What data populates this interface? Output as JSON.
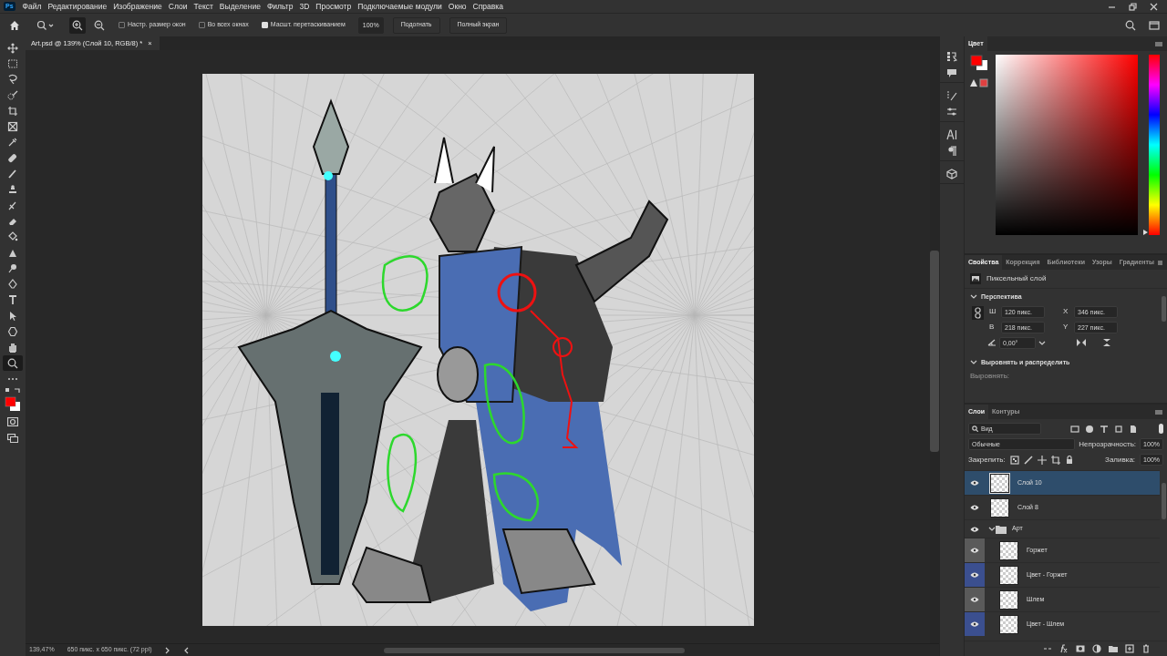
{
  "app_logo": "Ps",
  "menu": [
    "Файл",
    "Редактирование",
    "Изображение",
    "Слои",
    "Текст",
    "Выделение",
    "Фильтр",
    "3D",
    "Просмотр",
    "Подключаемые модули",
    "Окно",
    "Справка"
  ],
  "options_bar": {
    "zoom_in_selected": true,
    "checkboxes": [
      {
        "label": "Настр. размер окон",
        "checked": false
      },
      {
        "label": "Во всех окнах",
        "checked": false
      },
      {
        "label": "Масшт. перетаскиванием",
        "checked": true
      }
    ],
    "zoom_value": "100%",
    "buttons": [
      "Подогнать",
      "Полный экран"
    ]
  },
  "tools": [
    {
      "selected": false
    },
    {
      "selected": false
    },
    {
      "selected": false
    },
    {
      "selected": false
    },
    {
      "selected": false
    },
    {
      "selected": false
    },
    {
      "selected": false
    },
    {
      "selected": false
    },
    {
      "selected": false
    },
    {
      "selected": false
    },
    {
      "selected": false
    },
    {
      "selected": false
    },
    {
      "selected": false
    },
    {
      "selected": false
    },
    {
      "selected": false
    },
    {
      "selected": false
    },
    {
      "selected": false
    },
    {
      "selected": false
    },
    {
      "selected": false
    },
    {
      "selected": false
    },
    {
      "selected": true
    },
    {
      "selected": false
    }
  ],
  "document_tab": {
    "title": "Art.psd @ 139% (Слой 10, RGB/8) *",
    "close": "×"
  },
  "status_bar": {
    "zoom": "139,47%",
    "info": "650 пикс. x 650 пикс. (72 ppi)"
  },
  "color_panel": {
    "tab": "Цвет",
    "hue_slider": {
      "level": 0
    }
  },
  "properties_panel": {
    "tabs": [
      {
        "label": "Свойства",
        "selected": true
      },
      {
        "label": "Коррекция",
        "selected": false
      },
      {
        "label": "Библиотеки",
        "selected": false
      },
      {
        "label": "Узоры",
        "selected": false
      },
      {
        "label": "Градиенты",
        "selected": false
      }
    ],
    "layer_type": "Пиксельный слой",
    "perspective": {
      "title": "Перспектива",
      "expanded": true,
      "fields": [
        {
          "label": "Ш",
          "value": "120 пикс."
        },
        {
          "label": "X",
          "value": "346 пикс."
        },
        {
          "label": "В",
          "value": "218 пикс."
        },
        {
          "label": "Y",
          "value": "227 пикс."
        }
      ],
      "angle": "0,00°"
    },
    "align": {
      "title": "Выровнять и распределить",
      "expanded": true,
      "label": "Выровнять:"
    }
  },
  "layers_panel": {
    "tabs": [
      {
        "label": "Слои",
        "selected": true
      },
      {
        "label": "Контуры",
        "selected": false
      }
    ],
    "filter": "Вид",
    "blend_mode": "Обычные",
    "opacity_label": "Непрозрачность:",
    "opacity": "100%",
    "lock_label": "Закрепить:",
    "fill_label": "Заливка:",
    "fill": "100%",
    "layers": [
      {
        "kind": "layer",
        "name": "Слой 10",
        "visible": true,
        "selected": true
      },
      {
        "kind": "layer",
        "name": "Слой 8",
        "visible": true,
        "selected": false
      },
      {
        "kind": "group",
        "name": "Арт",
        "visible": true,
        "selected": false,
        "expanded": true,
        "children": [
          {
            "kind": "layer",
            "name": "Горжет",
            "visible": true,
            "selected": false,
            "color": "#5a5a5a"
          },
          {
            "kind": "layer",
            "name": "Цвет - Горжет",
            "visible": true,
            "selected": false,
            "color": "#3b4f8f"
          },
          {
            "kind": "layer",
            "name": "Шлем",
            "visible": true,
            "selected": false,
            "color": "#5a5a5a"
          },
          {
            "kind": "layer",
            "name": "Цвет - Шлем",
            "visible": true,
            "selected": false,
            "color": "#3b4f8f"
          }
        ]
      }
    ]
  }
}
